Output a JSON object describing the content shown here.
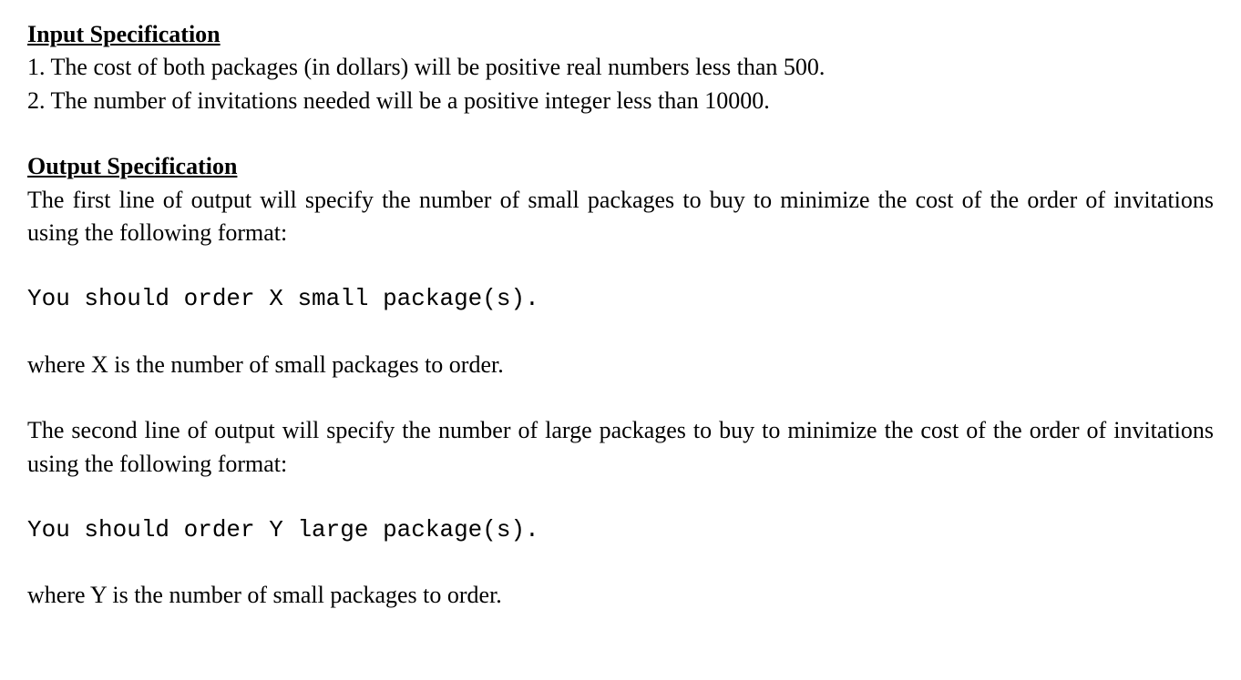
{
  "sections": {
    "input": {
      "heading": "Input Specification",
      "items": [
        "1. The cost of both packages (in dollars) will be positive real numbers less than 500.",
        "2. The number of invitations needed will be a positive integer less than 10000."
      ]
    },
    "output": {
      "heading": "Output Specification",
      "para1": "The first line of output will specify the number of small packages to buy to minimize the cost of the order of invitations using the following format:",
      "code1": "You should order X small package(s).",
      "para2": "where X is the number of small packages to order.",
      "para3": "The second line of output will specify the number of large packages to buy to minimize the cost of the order of invitations using the following format:",
      "code2": "You should order Y large package(s).",
      "para4": "where Y is the number of small packages to order."
    }
  }
}
